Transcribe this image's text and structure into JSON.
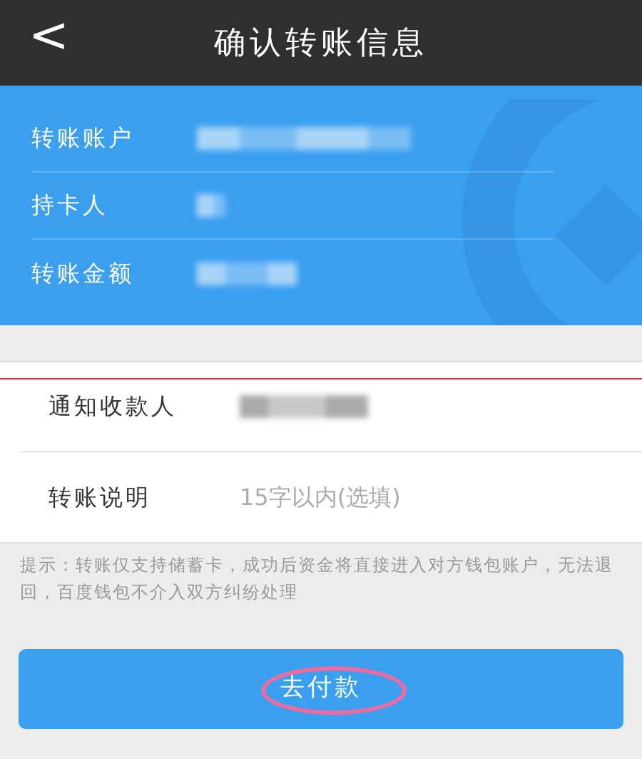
{
  "header": {
    "back": "<",
    "title": "确认转账信息"
  },
  "summary": [
    {
      "label": "转账账户",
      "redacted": true
    },
    {
      "label": "持卡人",
      "redacted": true
    },
    {
      "label": "转账金额",
      "redacted": true
    }
  ],
  "form": [
    {
      "kind": "redacted",
      "label": "通知收款人"
    },
    {
      "kind": "input",
      "label": "转账说明",
      "placeholder": "15字以内(选填)"
    }
  ],
  "hint": "提示：转账仅支持储蓄卡，成功后资金将直接进入对方钱包账户，无法退回，百度钱包不介入双方纠纷处理",
  "pay_button": {
    "label": "去付款",
    "circled": true
  }
}
